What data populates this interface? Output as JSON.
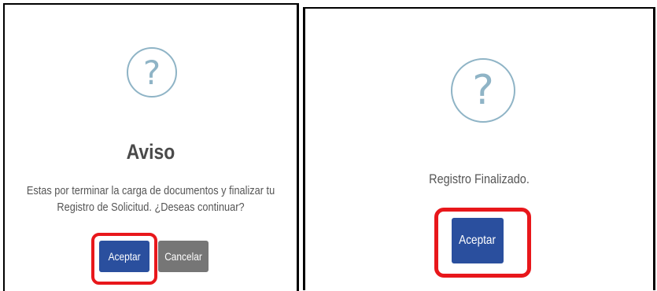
{
  "dialog_left": {
    "icon": "question-mark-icon",
    "title": "Aviso",
    "message_line1": "Estas por terminar la carga de documentos y finalizar tu",
    "message_line2": "Registro de Solicitud. ¿Deseas continuar?",
    "accept_label": "Aceptar",
    "cancel_label": "Cancelar"
  },
  "dialog_right": {
    "icon": "question-mark-icon",
    "message": "Registro Finalizado.",
    "accept_label": "Aceptar"
  },
  "colors": {
    "primary_button": "#2a4f9e",
    "secondary_button": "#767676",
    "highlight": "#e8171b",
    "icon": "#8fb4c6"
  }
}
